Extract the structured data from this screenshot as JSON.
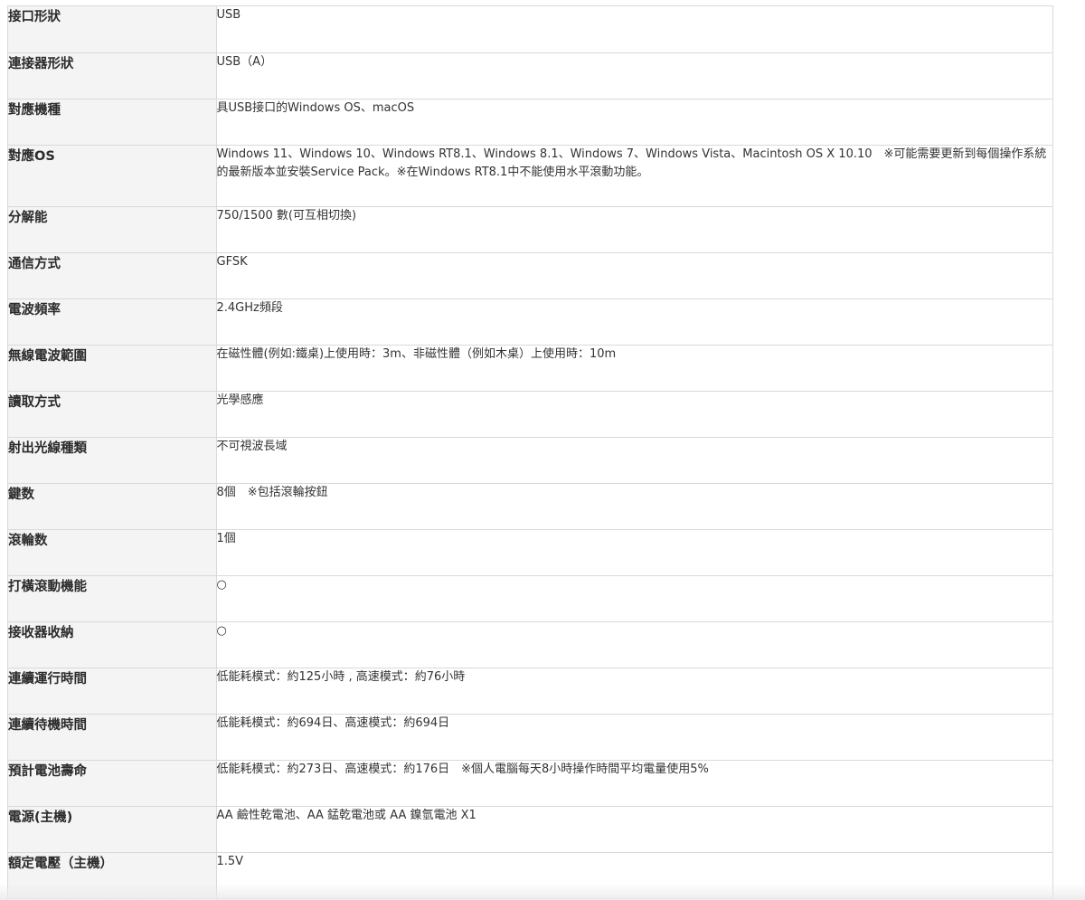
{
  "specs": [
    {
      "label": "接口形狀",
      "value": "USB"
    },
    {
      "label": "連接器形狀",
      "value": "USB（A）"
    },
    {
      "label": "對應機種",
      "value": "具USB接口的Windows OS、macOS"
    },
    {
      "label": "對應OS",
      "value": "Windows 11、Windows 10、Windows RT8.1、Windows 8.1、Windows 7、Windows Vista、Macintosh OS X 10.10　※可能需要更新到每個操作系統的最新版本並安裝Service Pack。※在Windows RT8.1中不能使用水平滾動功能。"
    },
    {
      "label": "分解能",
      "value": "750/1500 數(可互相切換)"
    },
    {
      "label": "通信方式",
      "value": "GFSK"
    },
    {
      "label": "電波頻率",
      "value": "2.4GHz頻段"
    },
    {
      "label": "無線電波範圍",
      "value": "在磁性體(例如:鐵桌)上使用時：3m、非磁性體（例如木桌）上使用時：10m"
    },
    {
      "label": "讀取方式",
      "value": "光學感應"
    },
    {
      "label": "射出光線種類",
      "value": "不可視波長域"
    },
    {
      "label": "鍵数",
      "value": "8個　※包括滾輪按鈕"
    },
    {
      "label": "滾輪数",
      "value": "1個"
    },
    {
      "label": "打橫滾動機能",
      "value": "○"
    },
    {
      "label": "接收器收納",
      "value": "○"
    },
    {
      "label": "連續運行時間",
      "value": "低能耗模式：約125小時 , 高速模式：約76小時"
    },
    {
      "label": "連續待機時間",
      "value": "低能耗模式：約694日、高速模式：約694日"
    },
    {
      "label": "預計電池壽命",
      "value": "低能耗模式：約273日、高速模式：約176日　※個人電腦每天8小時操作時間平均電量使用5%"
    },
    {
      "label": "電源(主機)",
      "value": "AA 鹼性乾電池、AA 錳乾電池或 AA 鎳氫電池 X1"
    },
    {
      "label": "額定電壓（主機）",
      "value": "1.5V"
    }
  ]
}
